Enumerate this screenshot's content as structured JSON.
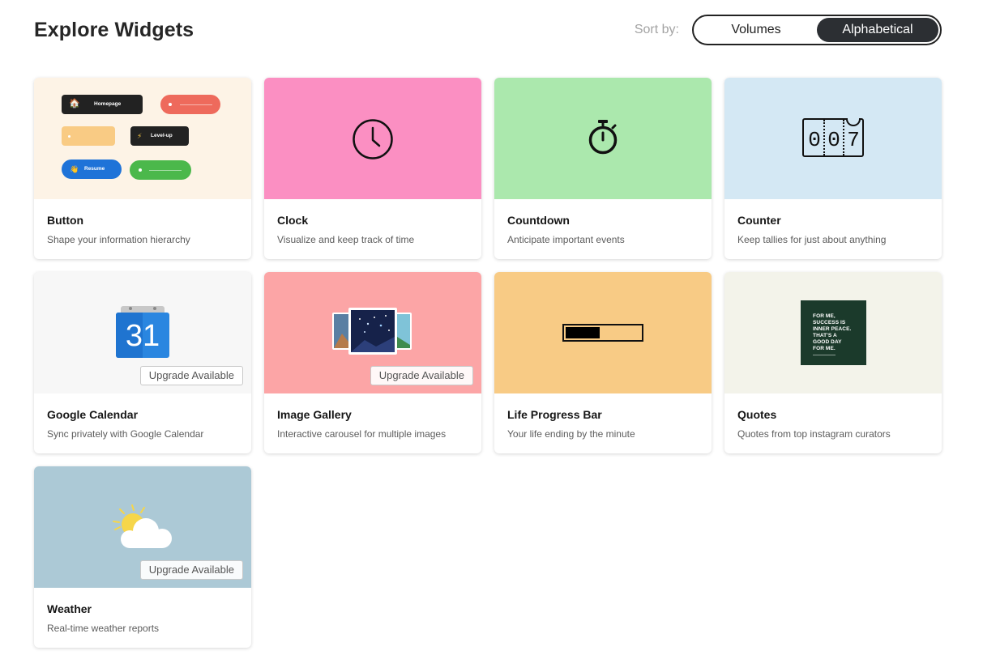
{
  "header": {
    "title": "Explore Widgets",
    "sort_label": "Sort by:",
    "sort_options": [
      "Volumes",
      "Alphabetical"
    ],
    "sort_selected": "Alphabetical"
  },
  "upgrade_label": "Upgrade Available",
  "widgets": [
    {
      "name": "Button",
      "description": "Shape your information hierarchy",
      "bg": "#fdf3e6",
      "preview": {
        "homepage": "Homepage",
        "levelup": "Level-up",
        "resume": "Resume"
      }
    },
    {
      "name": "Clock",
      "description": "Visualize and keep track of time",
      "bg": "#fb8fc2",
      "icon": "clock-icon"
    },
    {
      "name": "Countdown",
      "description": "Anticipate important events",
      "bg": "#abe8ad",
      "icon": "stopwatch-icon"
    },
    {
      "name": "Counter",
      "description": "Keep tallies for just about anything",
      "bg": "#d4e8f4",
      "icon": "counter-icon",
      "digits": [
        "0",
        "0",
        "7"
      ]
    },
    {
      "name": "Google Calendar",
      "description": "Sync privately with Google Calendar",
      "bg": "#f7f7f7",
      "icon": "calendar-icon",
      "calendar_day": "31",
      "upgrade": true
    },
    {
      "name": "Image Gallery",
      "description": "Interactive carousel for multiple images",
      "bg": "#fca5a6",
      "icon": "gallery-icon",
      "upgrade": true
    },
    {
      "name": "Life Progress Bar",
      "description": "Your life ending by the minute",
      "bg": "#f8cb85",
      "icon": "progress-bar-icon",
      "progress": 0.46
    },
    {
      "name": "Quotes",
      "description": "Quotes from top instagram curators",
      "bg": "#f3f3ea",
      "icon": "quote-card",
      "quote_lines": [
        "FOR ME,",
        "SUCCESS IS",
        "INNER PEACE.",
        "THAT'S A",
        "GOOD DAY",
        "FOR ME."
      ]
    },
    {
      "name": "Weather",
      "description": "Real-time weather reports",
      "bg": "#acc9d6",
      "icon": "sun-cloud-icon",
      "upgrade": true
    }
  ]
}
